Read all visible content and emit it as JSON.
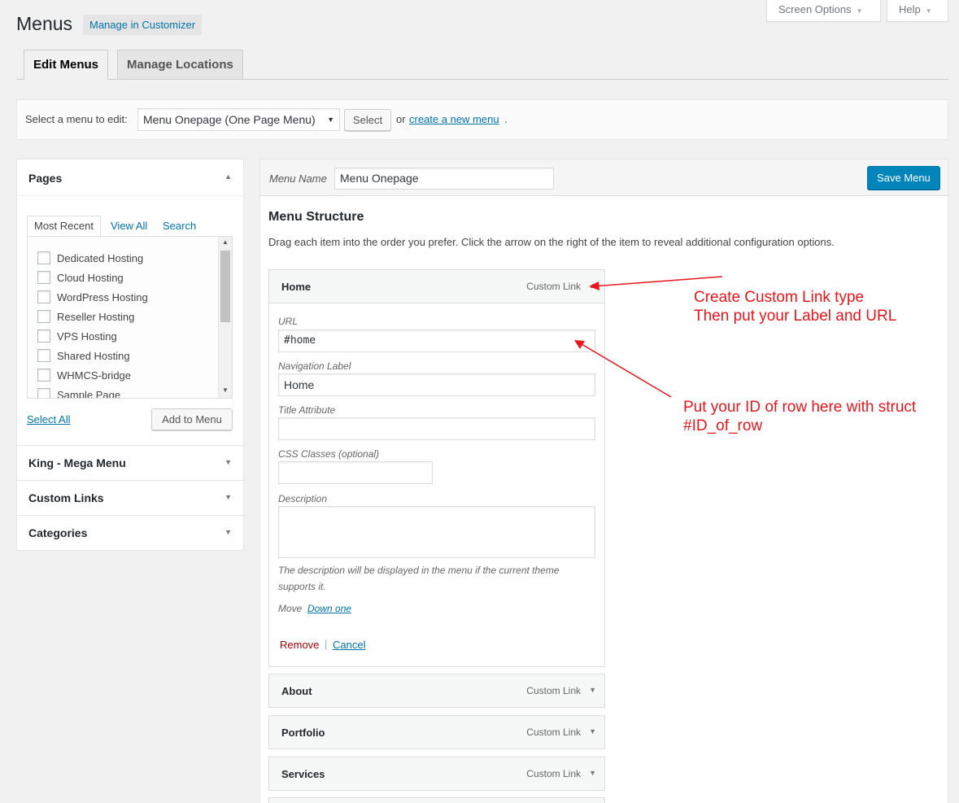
{
  "header": {
    "title": "Menus",
    "customizer_label": "Manage in Customizer",
    "screen_options_label": "Screen Options",
    "help_label": "Help"
  },
  "tabs": [
    {
      "label": "Edit Menus",
      "active": true
    },
    {
      "label": "Manage Locations",
      "active": false
    }
  ],
  "manage_bar": {
    "select_label": "Select a menu to edit:",
    "selected_menu": "Menu Onepage (One Page Menu)",
    "select_button": "Select",
    "or_text": "or",
    "create_link": "create a new menu",
    "period": "."
  },
  "pages_box": {
    "title": "Pages",
    "tabs": [
      "Most Recent",
      "View All",
      "Search"
    ],
    "items": [
      "Dedicated Hosting",
      "Cloud Hosting",
      "WordPress Hosting",
      "Reseller Hosting",
      "VPS Hosting",
      "Shared Hosting",
      "WHMCS-bridge",
      "Sample Page"
    ],
    "select_all": "Select All",
    "add_button": "Add to Menu"
  },
  "accordions": [
    "King - Mega Menu",
    "Custom Links",
    "Categories"
  ],
  "menu_editor": {
    "name_label": "Menu Name",
    "name_value": "Menu Onepage",
    "save_button": "Save Menu",
    "structure_title": "Menu Structure",
    "structure_desc": "Drag each item into the order you prefer. Click the arrow on the right of the item to reveal additional configuration options."
  },
  "open_item": {
    "title": "Home",
    "type": "Custom Link",
    "url_label": "URL",
    "url_value": "#home",
    "nav_label_label": "Navigation Label",
    "nav_label_value": "Home",
    "title_attr_label": "Title Attribute",
    "title_attr_value": "",
    "css_label": "CSS Classes (optional)",
    "css_value": "",
    "desc_label": "Description",
    "desc_value": "",
    "desc_hint": "The description will be displayed in the menu if the current theme supports it.",
    "move_label": "Move",
    "move_link": "Down one",
    "remove_link": "Remove",
    "separator": "|",
    "cancel_link": "Cancel"
  },
  "menu_items": [
    {
      "title": "About",
      "type": "Custom Link"
    },
    {
      "title": "Portfolio",
      "type": "Custom Link"
    },
    {
      "title": "Services",
      "type": "Custom Link"
    }
  ],
  "annotations": {
    "note1_line1": "Create Custom Link type",
    "note1_line2": "Then put your Label and URL",
    "note2_line1": "Put your ID of row here with struct",
    "note2_line2": "#ID_of_row"
  },
  "colors": {
    "annotation": "#e8161c",
    "primary_button": "#0085ba",
    "link": "#0073aa",
    "remove": "#aa0000"
  }
}
